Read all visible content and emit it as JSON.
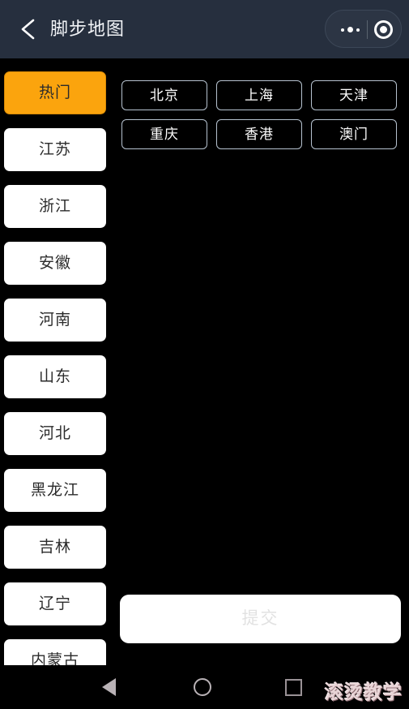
{
  "header": {
    "title": "脚步地图",
    "back_icon": "arrow-left-icon",
    "capsule": {
      "menu_icon": "more-dots-icon",
      "target_icon": "target-circle-icon"
    }
  },
  "sidebar": {
    "items": [
      {
        "label": "热门",
        "active": true
      },
      {
        "label": "江苏",
        "active": false
      },
      {
        "label": "浙江",
        "active": false
      },
      {
        "label": "安徽",
        "active": false
      },
      {
        "label": "河南",
        "active": false
      },
      {
        "label": "山东",
        "active": false
      },
      {
        "label": "河北",
        "active": false
      },
      {
        "label": "黑龙江",
        "active": false
      },
      {
        "label": "吉林",
        "active": false
      },
      {
        "label": "辽宁",
        "active": false
      },
      {
        "label": "内蒙古",
        "active": false
      }
    ]
  },
  "content": {
    "chips": [
      {
        "label": "北京"
      },
      {
        "label": "上海"
      },
      {
        "label": "天津"
      },
      {
        "label": "重庆"
      },
      {
        "label": "香港"
      },
      {
        "label": "澳门"
      }
    ],
    "submit_label": "提交"
  },
  "navbar": {
    "back_icon": "triangle-back-icon",
    "home_icon": "circle-home-icon",
    "recents_icon": "square-recents-icon",
    "watermark": "滚烫教学"
  },
  "colors": {
    "accent_active": "#fba40d",
    "header_bg": "#262f3e",
    "gradient_top": "#262f3e",
    "gradient_bottom": "#4c89ba",
    "chip_border": "#b6c2cf",
    "submit_text": "#e2e2e2"
  }
}
